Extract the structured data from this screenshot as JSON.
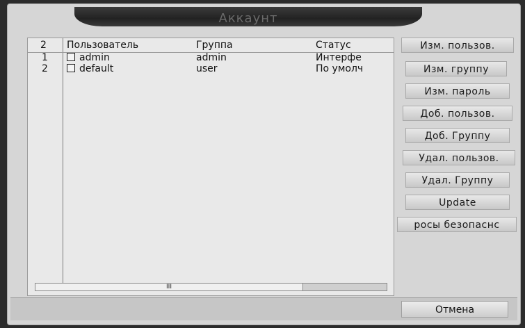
{
  "window": {
    "title": "Аккаунт"
  },
  "table": {
    "headers": [
      "2",
      "Пользователь",
      "Группа",
      "Статус"
    ],
    "rows": [
      {
        "index": "1",
        "user": "admin",
        "group": "admin",
        "status": "Интерфе"
      },
      {
        "index": "2",
        "user": "default",
        "group": "user",
        "status": "По умолч"
      }
    ],
    "scroll_thumb_text": "III"
  },
  "buttons": {
    "modify_user": "Изм. пользов.",
    "modify_group": "Изм. группу",
    "modify_password": "Изм. пароль",
    "add_user": "Доб. пользов.",
    "add_group": "Доб. Группу",
    "delete_user": "Удал. пользов.",
    "delete_group": "Удал. Группу",
    "update": "Update",
    "security_questions": "росы безопаснс",
    "cancel": "Отмена"
  }
}
